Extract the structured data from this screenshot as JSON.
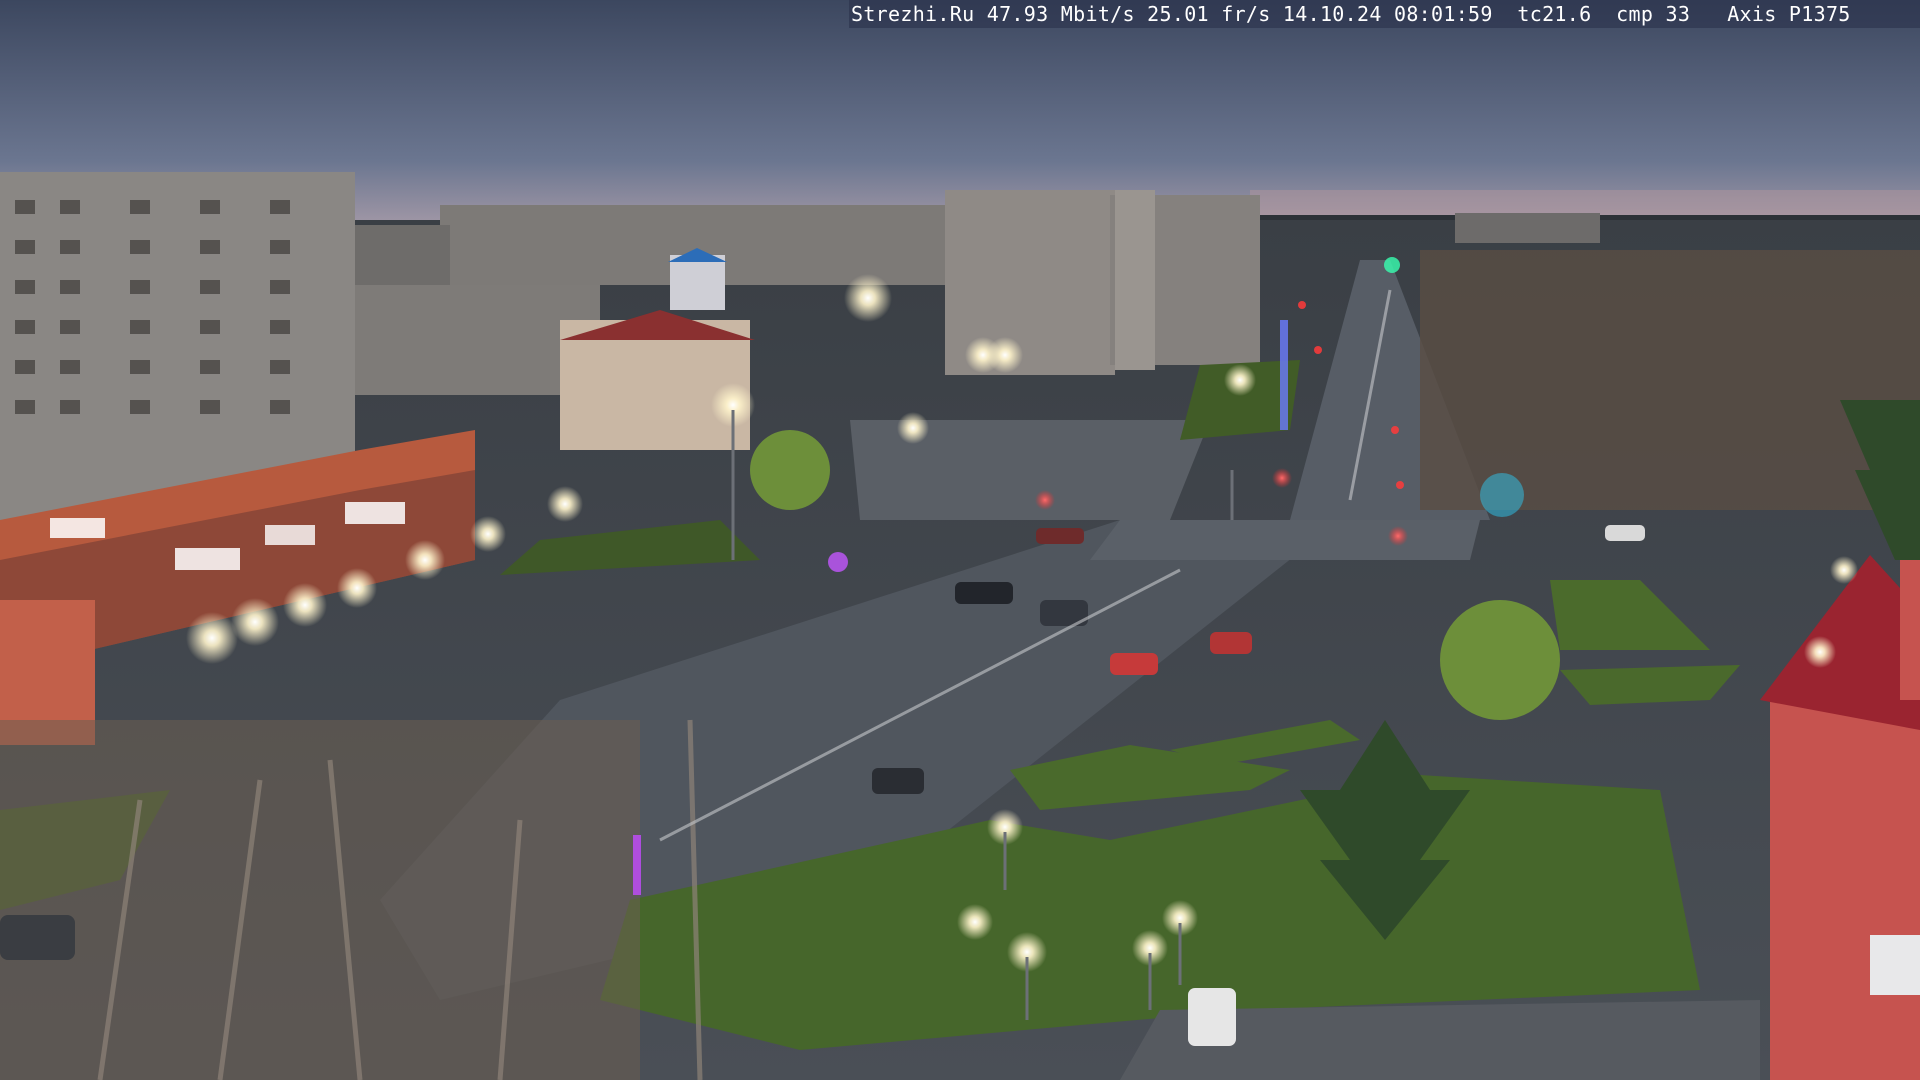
{
  "overlay": {
    "text": "Strezhi.Ru 47.93 Mbit/s 25.01 fr/s 14.10.24 08:01:59  tc21.6  cmp 33   Axis P1375"
  },
  "scene": {
    "subject": "street-intersection-at-dusk",
    "colors": {
      "sky_top": "#3e4a63",
      "sky_horizon": "#8a8fa8",
      "horizon_glow": "#c99a8f",
      "road": "#4e5560",
      "lawn": "#4b6a2e",
      "building_grey": "#8d8a86",
      "shop_red": "#b8533a",
      "streetlight": "#fff6d8"
    }
  }
}
